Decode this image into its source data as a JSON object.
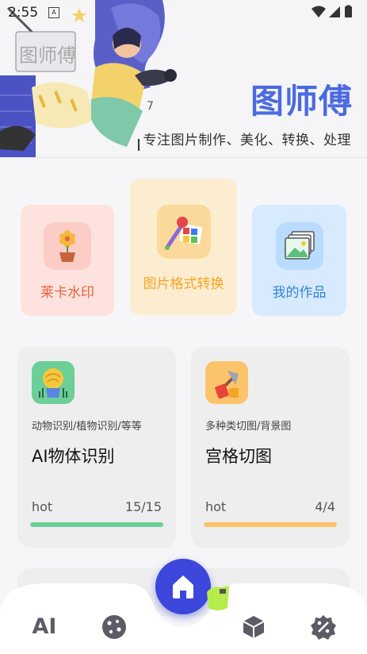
{
  "status_bar": {
    "time": "2:55",
    "app_badge": "A"
  },
  "header": {
    "app_title": "图师傅",
    "subtitle": "专注图片制作、美化、转换、处理"
  },
  "tools": [
    {
      "label": "莱卡水印",
      "icon": "flower-pot-icon",
      "color": "#e8643c"
    },
    {
      "label": "图片格式转换",
      "icon": "color-palette-icon",
      "color": "#f5a524"
    },
    {
      "label": "我的作品",
      "icon": "photo-gallery-icon",
      "color": "#2f86d8"
    }
  ],
  "features": [
    {
      "desc": "动物识别/植物识别/等等",
      "title": "AI物体识别",
      "hot": "hot",
      "count": "15/15",
      "progress": 1.0,
      "accent": "#6ccf97",
      "icon": "ai-brain-icon"
    },
    {
      "desc": "多种类切图/背景图",
      "title": "宫格切图",
      "hot": "hot",
      "count": "4/4",
      "progress": 1.0,
      "accent": "#fcc46a",
      "icon": "axe-cut-icon"
    }
  ],
  "nav": {
    "ai_label": "AI",
    "items": [
      "ai-tab",
      "cookie-icon",
      "home-icon",
      "cube-icon",
      "percent-badge-icon"
    ],
    "active": "home",
    "accent": "#3d47dc"
  }
}
